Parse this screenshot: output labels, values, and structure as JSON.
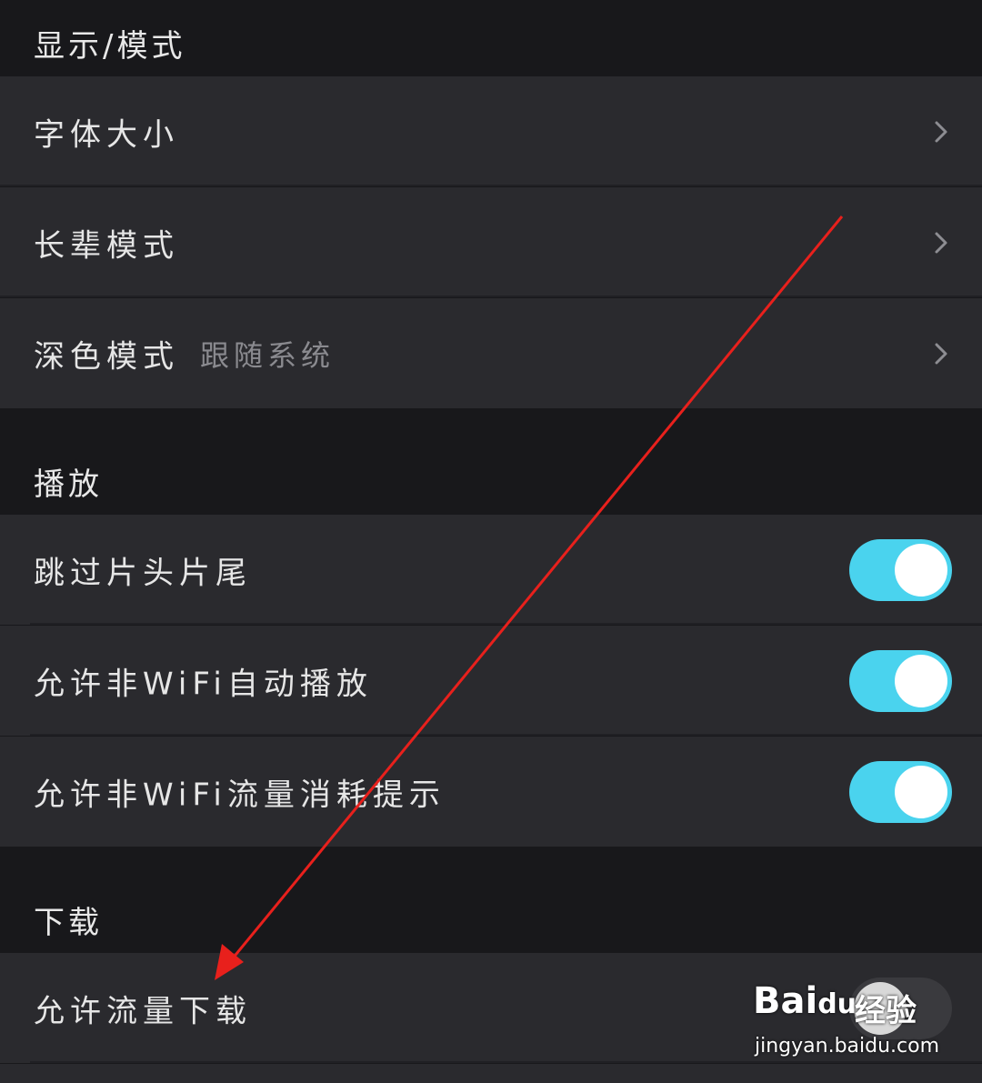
{
  "sections": {
    "display": {
      "header": "显示/模式",
      "rows": [
        {
          "label": "字体大小"
        },
        {
          "label": "长辈模式"
        },
        {
          "label": "深色模式",
          "value": "跟随系统"
        }
      ]
    },
    "playback": {
      "header": "播放",
      "rows": [
        {
          "label": "跳过片头片尾",
          "on": true
        },
        {
          "label": "允许非WiFi自动播放",
          "on": true
        },
        {
          "label": "允许非WiFi流量消耗提示",
          "on": true
        }
      ]
    },
    "download": {
      "header": "下载",
      "rows": [
        {
          "label": "允许流量下载",
          "on": false
        }
      ]
    }
  },
  "watermark": {
    "logo": "Bai",
    "logo_suffix": "du",
    "brand": "经验",
    "url": "jingyan.baidu.com"
  },
  "colors": {
    "background": "#18181b",
    "row": "#2a2a2e",
    "toggle_on": "#4ad3ee",
    "annotation_arrow": "#e8201c"
  }
}
